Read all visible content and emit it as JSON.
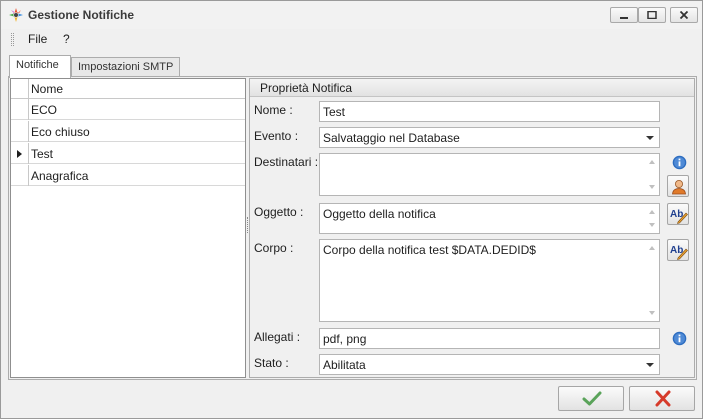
{
  "window": {
    "title": "Gestione Notifiche",
    "controls": [
      "minimize",
      "maximize",
      "close"
    ]
  },
  "menu": {
    "items": [
      "File",
      "?"
    ]
  },
  "tabs": [
    {
      "label": "Notifiche",
      "active": true
    },
    {
      "label": "Impostazioni SMTP",
      "active": false
    }
  ],
  "list": {
    "column_header": "Nome",
    "rows": [
      {
        "name": "ECO",
        "selected": false
      },
      {
        "name": "Eco chiuso",
        "selected": false
      },
      {
        "name": "Test",
        "selected": true
      },
      {
        "name": "Anagrafica",
        "selected": false
      }
    ]
  },
  "properties": {
    "group_title": "Proprietà Notifica",
    "nome_label": "Nome :",
    "nome_value": "Test",
    "evento_label": "Evento :",
    "evento_value": "Salvataggio nel Database",
    "destinatari_label": "Destinatari :",
    "destinatari_value": "",
    "oggetto_label": "Oggetto :",
    "oggetto_value": "Oggetto della notifica",
    "corpo_label": "Corpo :",
    "corpo_value": "Corpo della notifica test $DATA.DEDID$",
    "allegati_label": "Allegati :",
    "allegati_value": "pdf, png",
    "stato_label": "Stato :",
    "stato_value": "Abilitata"
  },
  "icons": {
    "info": "info-icon",
    "user": "user-icon",
    "spell": "spellcheck-icon",
    "ok": "check-icon",
    "cancel": "x-icon"
  },
  "colors": {
    "ok_green": "#5aa35a",
    "cancel_red": "#d63a2a",
    "info_blue": "#2c6cbf"
  }
}
